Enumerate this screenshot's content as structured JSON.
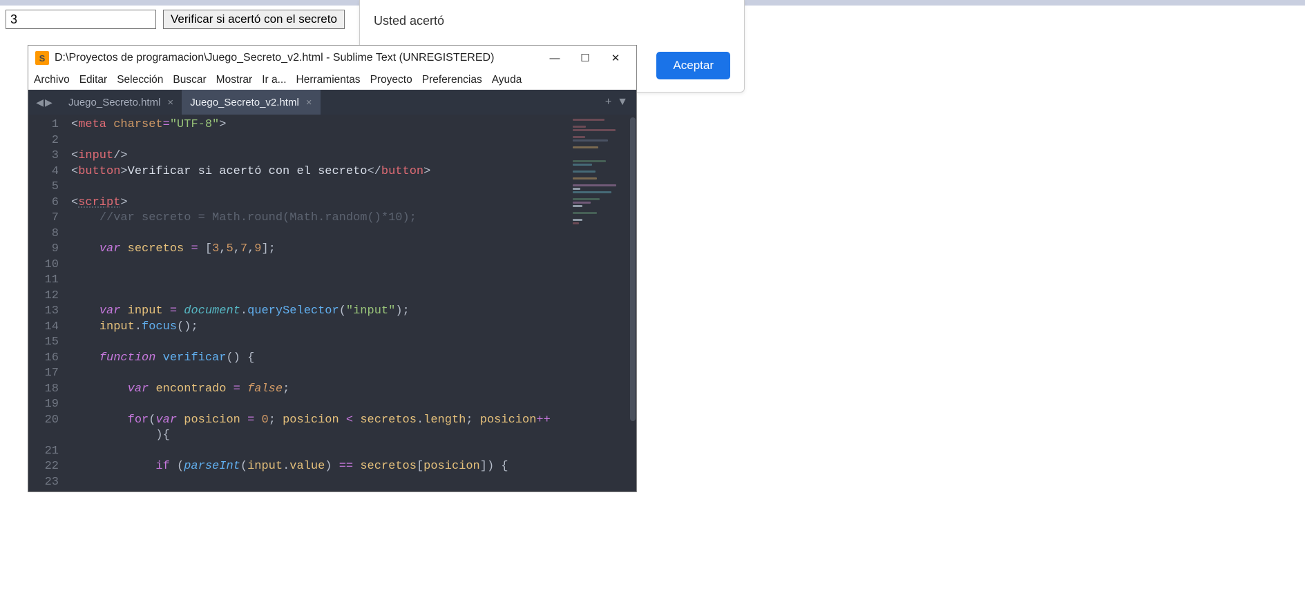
{
  "browser": {
    "input_value": "3",
    "verify_button": "Verificar si acertó con el secreto"
  },
  "dialog": {
    "message": "Usted acertó",
    "accept": "Aceptar"
  },
  "sublime": {
    "title": "D:\\Proyectos de programacion\\Juego_Secreto_v2.html - Sublime Text (UNREGISTERED)",
    "menu": [
      "Archivo",
      "Editar",
      "Selección",
      "Buscar",
      "Mostrar",
      "Ir a...",
      "Herramientas",
      "Proyecto",
      "Preferencias",
      "Ayuda"
    ],
    "tabs": [
      {
        "label": "Juego_Secreto.html",
        "active": false
      },
      {
        "label": "Juego_Secreto_v2.html",
        "active": true
      }
    ],
    "line_numbers": [
      "1",
      "2",
      "3",
      "4",
      "5",
      "6",
      "7",
      "8",
      "9",
      "10",
      "11",
      "12",
      "13",
      "14",
      "15",
      "16",
      "17",
      "18",
      "19",
      "20",
      "",
      "21",
      "22",
      "23"
    ],
    "code": {
      "l1_meta": "meta",
      "l1_charset_attr": "charset",
      "l1_charset_val": "\"UTF-8\"",
      "l3_input": "input",
      "l4_button": "button",
      "l4_text": "Verificar si acertó con el secreto",
      "l6_script": "script",
      "l7_cmt": "//var secreto = Math.round(Math.random()*10);",
      "l9_var": "var",
      "l9_name": "secretos",
      "l9_vals": "[3,5,7,9]",
      "l13_var": "var",
      "l13_name": "input",
      "l13_doc": "document",
      "l13_qs": "querySelector",
      "l13_arg": "\"input\"",
      "l14_input": "input",
      "l14_focus": "focus",
      "l16_fn": "function",
      "l16_name": "verificar",
      "l18_var": "var",
      "l18_name": "encontrado",
      "l18_false": "false",
      "l20_for": "for",
      "l20_var": "var",
      "l20_pos": "posicion",
      "l20_zero": "0",
      "l20_pos2": "posicion",
      "l20_sec": "secretos",
      "l20_len": "length",
      "l20_pos3": "posicion",
      "l22_if": "if",
      "l22_pi": "parseInt",
      "l22_inp": "input",
      "l22_val": "value",
      "l22_sec": "secretos",
      "l22_pos": "posicion"
    }
  }
}
